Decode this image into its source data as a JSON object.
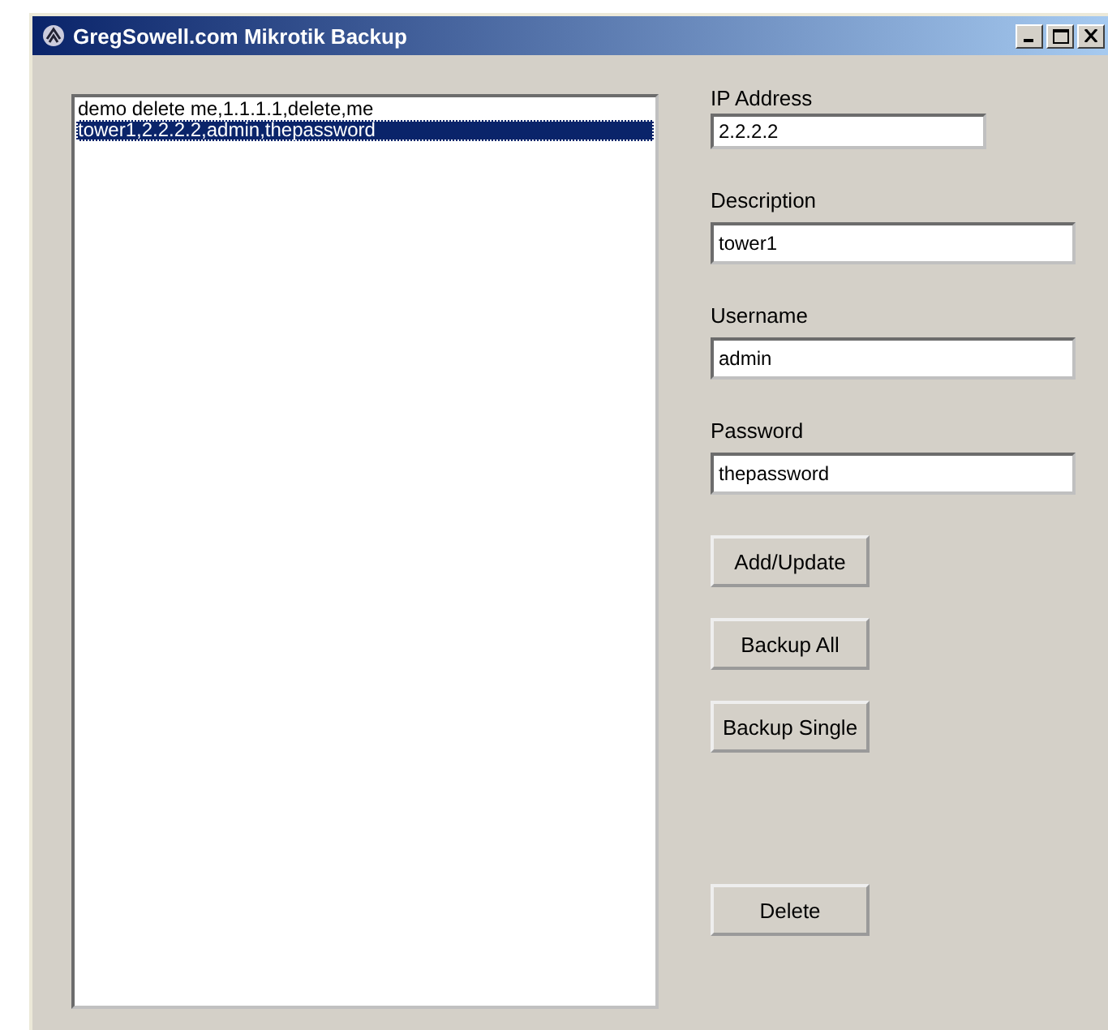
{
  "window": {
    "title": "GregSowell.com Mikrotik Backup"
  },
  "list": {
    "items": [
      {
        "text": "demo delete me,1.1.1.1,delete,me",
        "selected": false
      },
      {
        "text": "tower1,2.2.2.2,admin,thepassword",
        "selected": true
      }
    ]
  },
  "fields": [
    {
      "label": "IP Address",
      "value": "2.2.2.2",
      "kind": "short"
    },
    {
      "label": "Description",
      "value": "tower1",
      "kind": "wide"
    },
    {
      "label": "Username",
      "value": "admin",
      "kind": "wide"
    },
    {
      "label": "Password",
      "value": "thepassword",
      "kind": "wide"
    }
  ],
  "buttons": [
    {
      "label": "Add/Update"
    },
    {
      "label": "Backup All"
    },
    {
      "label": "Backup Single"
    },
    {
      "label": "Delete"
    }
  ]
}
